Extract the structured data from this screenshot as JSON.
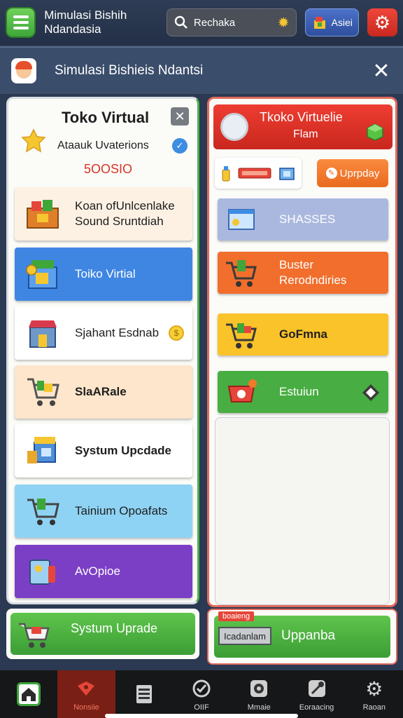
{
  "header": {
    "app_title_line1": "Mimulasi Bishih",
    "app_title_line2": "Ndandasia",
    "search_text": "Rechaka",
    "asset_label": "Asiei"
  },
  "subheader": {
    "title": "Simulasi Bishieis Ndantsi"
  },
  "left_panel": {
    "title": "Toko Virtual",
    "subtitle": "Ataauk Uvaterions",
    "money": "5OOSIO",
    "items": [
      {
        "line1": "Koan ofUnlcenlake",
        "line2": "Sound Sruntdiah",
        "bg": "#fdf1e4"
      },
      {
        "line1": "Toiko Virtial",
        "line2": "",
        "bg": "#3f86e3"
      },
      {
        "line1": "Sjahant Esdnab",
        "line2": "",
        "bg": "#ffffff"
      },
      {
        "line1": "SlaARale",
        "line2": "",
        "bg": "#fde6cc"
      },
      {
        "line1": "Systum Upcdade",
        "line2": "",
        "bg": "#ffffff"
      },
      {
        "line1": "Tainium Opoafats",
        "line2": "",
        "bg": "#8fd3f4"
      },
      {
        "line1": "AvOpioe",
        "line2": "",
        "bg": "#7b3fc6"
      }
    ]
  },
  "right_panel": {
    "head_line1": "Tkoko Virtuelie",
    "head_line2": "Flam",
    "update_label": "Uprpday",
    "buttons": [
      {
        "line1": "SHASSES",
        "line2": "",
        "bg": "#aab8df"
      },
      {
        "line1": "Buster",
        "line2": "Rerodndiries",
        "bg": "#f16e2c"
      },
      {
        "line1": "GoFmna",
        "line2": "",
        "bg": "#fbc32a"
      },
      {
        "line1": "Estuiun",
        "line2": "",
        "bg": "#48ad42"
      }
    ]
  },
  "bottom_actions": {
    "left_label": "Systum Uprade",
    "right_tag": "boaieng",
    "right_chip": "Icadanlam",
    "right_label": "Uppanba"
  },
  "nav": [
    {
      "label": "",
      "icon": "home-icon"
    },
    {
      "label": "Nonsiie",
      "icon": "bag-icon"
    },
    {
      "label": "",
      "icon": "list-icon"
    },
    {
      "label": "OIIF",
      "icon": "shield-icon"
    },
    {
      "label": "Mmaie",
      "icon": "camera-icon"
    },
    {
      "label": "Eoraacing",
      "icon": "tools-icon"
    },
    {
      "label": "Raoan",
      "icon": "gear-icon"
    }
  ]
}
